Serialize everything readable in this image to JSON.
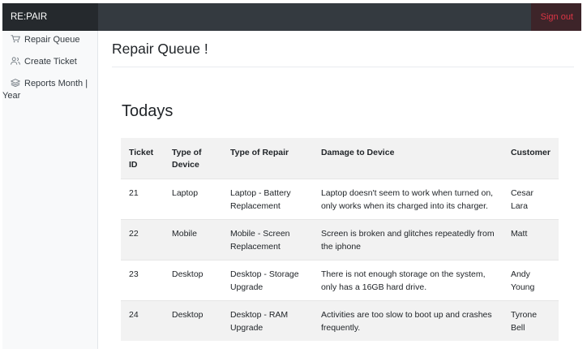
{
  "header": {
    "brand": "RE:PAIR",
    "signout_label": "Sign out"
  },
  "sidebar": {
    "items": [
      {
        "label": "Repair Queue",
        "icon": "cart-icon"
      },
      {
        "label": "Create Ticket",
        "icon": "users-icon"
      },
      {
        "label": "Reports Month |",
        "label_cont": "Year",
        "icon": "layers-icon"
      }
    ]
  },
  "main": {
    "title": "Repair Queue !",
    "section_title": "Todays"
  },
  "table": {
    "headers": {
      "ticket_id_1": "Ticket",
      "ticket_id_2": "ID",
      "type_device_1": "Type of",
      "type_device_2": "Device",
      "type_repair": "Type of Repair",
      "damage": "Damage to Device",
      "customer": "Customer"
    },
    "rows": [
      {
        "id": "21",
        "device": "Laptop",
        "repair_1": "Laptop - Battery",
        "repair_2": "Replacement",
        "damage_1": "Laptop doesn't seem to work when turned on,",
        "damage_2": "only works when its charged into its charger.",
        "customer_1": "Cesar Lara",
        "customer_2": ""
      },
      {
        "id": "22",
        "device": "Mobile",
        "repair_1": "Mobile - Screen",
        "repair_2": "Replacement",
        "damage_1": "Screen is broken and glitches repeatedly from",
        "damage_2": "the iphone",
        "customer_1": "Matt",
        "customer_2": ""
      },
      {
        "id": "23",
        "device": "Desktop",
        "repair_1": "Desktop - Storage",
        "repair_2": "Upgrade",
        "damage_1": "There is not enough storage on the system,",
        "damage_2": "only has a 16GB hard drive.",
        "customer_1": "Andy",
        "customer_2": "Young"
      },
      {
        "id": "24",
        "device": "Desktop",
        "repair_1": "Desktop - RAM",
        "repair_2": "Upgrade",
        "damage_1": "Activities are too slow to boot up and crashes",
        "damage_2": "frequently.",
        "customer_1": "Tyrone Bell",
        "customer_2": ""
      }
    ]
  },
  "colors": {
    "topbar": "#343a40",
    "brand_bg": "#25292d",
    "signout": "#dc3545",
    "sidebar": "#f8f9fa",
    "stripe": "#f2f2f2"
  }
}
